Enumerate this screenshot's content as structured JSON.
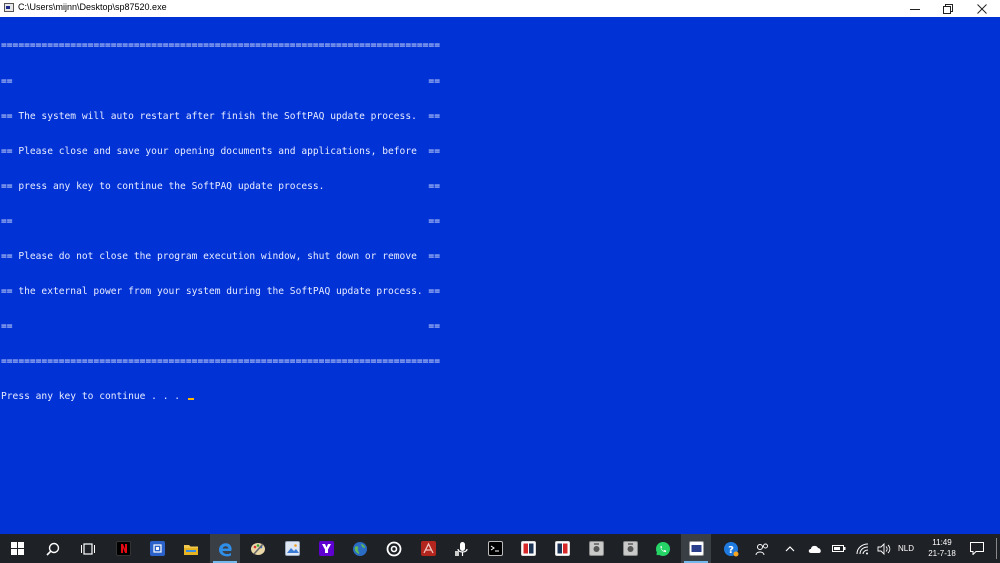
{
  "window": {
    "title": "C:\\Users\\mijnn\\Desktop\\sp87520.exe"
  },
  "console": {
    "lines": [
      "============================================================================",
      "==                                                                        ==",
      "== The system will auto restart after finish the SoftPAQ update process.  ==",
      "== Please close and save your opening documents and applications, before  ==",
      "== press any key to continue the SoftPAQ update process.                  ==",
      "==                                                                        ==",
      "== Please do not close the program execution window, shut down or remove  ==",
      "== the external power from your system during the SoftPAQ update process. ==",
      "==                                                                        ==",
      "============================================================================"
    ],
    "prompt": "Press any key to continue . . . "
  },
  "taskbar": {
    "language": "NLD",
    "time": "11:49",
    "date": "21-7-18"
  },
  "colors": {
    "console_bg": "#0032d6",
    "console_text": "#e8ecff",
    "cursor": "#ffb400",
    "taskbar_bg": "#1e2126"
  }
}
